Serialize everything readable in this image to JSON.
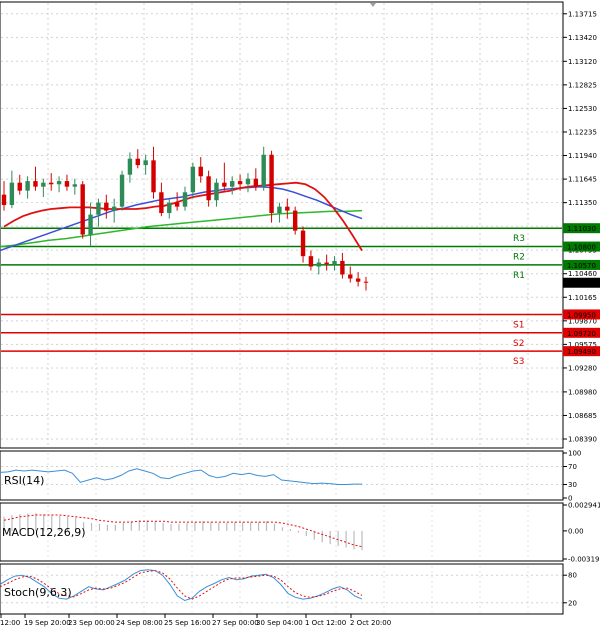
{
  "chart_data": {
    "type": "candlestick",
    "x_labels": [
      "12:00",
      "19 Sep 20:00",
      "23 Sep 00:00",
      "24 Sep 08:00",
      "25 Sep 16:00",
      "27 Sep 00:00",
      "30 Sep 04:00",
      "1 Oct 12:00",
      "2 Oct 20:00"
    ],
    "y_ticks": [
      1.13715,
      1.1342,
      1.1312,
      1.12825,
      1.1253,
      1.12235,
      1.1194,
      1.11645,
      1.1135,
      1.11055,
      1.10755,
      1.1046,
      1.10165,
      1.0987,
      1.09575,
      1.0928,
      1.0898,
      1.08685,
      1.0839
    ],
    "y_tick_labels": [
      "1.13715",
      "1.13420",
      "1.13120",
      "1.12825",
      "1.12530",
      "1.12235",
      "1.11940",
      "1.11645",
      "1.11350",
      "1.11055",
      "1.10755",
      "1.10460",
      "1.10165",
      "1.09870",
      "1.09575",
      "1.09280",
      "1.08980",
      "1.08685",
      "1.08390"
    ],
    "ylim": [
      1.0829,
      1.1385
    ],
    "current_price": {
      "label": "1.10347",
      "value": 1.10347
    },
    "levels": [
      {
        "name": "R3",
        "value": 1.1103,
        "label": "1.11030",
        "color": "#007a00"
      },
      {
        "name": "R2",
        "value": 1.108,
        "label": "1.10800",
        "color": "#007a00"
      },
      {
        "name": "R1",
        "value": 1.1057,
        "label": "1.10570",
        "color": "#007a00"
      },
      {
        "name": "S1",
        "value": 1.0995,
        "label": "1.09950",
        "color": "#e00000"
      },
      {
        "name": "S2",
        "value": 1.0972,
        "label": "1.09720",
        "color": "#e00000"
      },
      {
        "name": "S3",
        "value": 1.0949,
        "label": "1.09490",
        "color": "#e00000"
      }
    ],
    "candles": [
      {
        "o": 1.1145,
        "h": 1.1162,
        "l": 1.1125,
        "c": 1.1132
      },
      {
        "o": 1.1132,
        "h": 1.1175,
        "l": 1.1128,
        "c": 1.116
      },
      {
        "o": 1.116,
        "h": 1.117,
        "l": 1.1145,
        "c": 1.115
      },
      {
        "o": 1.115,
        "h": 1.1168,
        "l": 1.114,
        "c": 1.1162
      },
      {
        "o": 1.1162,
        "h": 1.118,
        "l": 1.115,
        "c": 1.1155
      },
      {
        "o": 1.1155,
        "h": 1.1165,
        "l": 1.1142,
        "c": 1.116
      },
      {
        "o": 1.116,
        "h": 1.1172,
        "l": 1.115,
        "c": 1.1158
      },
      {
        "o": 1.1158,
        "h": 1.1168,
        "l": 1.1148,
        "c": 1.1162
      },
      {
        "o": 1.1162,
        "h": 1.117,
        "l": 1.115,
        "c": 1.1155
      },
      {
        "o": 1.1155,
        "h": 1.1165,
        "l": 1.1145,
        "c": 1.1158
      },
      {
        "o": 1.1158,
        "h": 1.1162,
        "l": 1.109,
        "c": 1.1095
      },
      {
        "o": 1.1095,
        "h": 1.1135,
        "l": 1.108,
        "c": 1.112
      },
      {
        "o": 1.112,
        "h": 1.114,
        "l": 1.1105,
        "c": 1.1135
      },
      {
        "o": 1.1135,
        "h": 1.1145,
        "l": 1.1115,
        "c": 1.1125
      },
      {
        "o": 1.1125,
        "h": 1.114,
        "l": 1.111,
        "c": 1.113
      },
      {
        "o": 1.113,
        "h": 1.1175,
        "l": 1.1125,
        "c": 1.117
      },
      {
        "o": 1.117,
        "h": 1.1198,
        "l": 1.116,
        "c": 1.119
      },
      {
        "o": 1.119,
        "h": 1.1202,
        "l": 1.1178,
        "c": 1.1182
      },
      {
        "o": 1.1182,
        "h": 1.1195,
        "l": 1.117,
        "c": 1.1188
      },
      {
        "o": 1.1188,
        "h": 1.1205,
        "l": 1.114,
        "c": 1.1148
      },
      {
        "o": 1.1148,
        "h": 1.116,
        "l": 1.1118,
        "c": 1.1122
      },
      {
        "o": 1.1122,
        "h": 1.114,
        "l": 1.1115,
        "c": 1.1135
      },
      {
        "o": 1.1135,
        "h": 1.1148,
        "l": 1.1125,
        "c": 1.113
      },
      {
        "o": 1.113,
        "h": 1.1155,
        "l": 1.1125,
        "c": 1.1148
      },
      {
        "o": 1.1148,
        "h": 1.1185,
        "l": 1.114,
        "c": 1.118
      },
      {
        "o": 1.118,
        "h": 1.1192,
        "l": 1.116,
        "c": 1.1168
      },
      {
        "o": 1.1168,
        "h": 1.1175,
        "l": 1.113,
        "c": 1.1138
      },
      {
        "o": 1.1138,
        "h": 1.1165,
        "l": 1.113,
        "c": 1.116
      },
      {
        "o": 1.116,
        "h": 1.1185,
        "l": 1.115,
        "c": 1.1155
      },
      {
        "o": 1.1155,
        "h": 1.1168,
        "l": 1.1145,
        "c": 1.1162
      },
      {
        "o": 1.1162,
        "h": 1.117,
        "l": 1.115,
        "c": 1.1158
      },
      {
        "o": 1.1158,
        "h": 1.1172,
        "l": 1.1148,
        "c": 1.1165
      },
      {
        "o": 1.1165,
        "h": 1.1178,
        "l": 1.115,
        "c": 1.1155
      },
      {
        "o": 1.1155,
        "h": 1.1205,
        "l": 1.115,
        "c": 1.1195
      },
      {
        "o": 1.1195,
        "h": 1.12,
        "l": 1.111,
        "c": 1.1122
      },
      {
        "o": 1.1122,
        "h": 1.1135,
        "l": 1.111,
        "c": 1.113
      },
      {
        "o": 1.113,
        "h": 1.114,
        "l": 1.1115,
        "c": 1.1125
      },
      {
        "o": 1.1125,
        "h": 1.113,
        "l": 1.1095,
        "c": 1.11
      },
      {
        "o": 1.11,
        "h": 1.1105,
        "l": 1.106,
        "c": 1.1068
      },
      {
        "o": 1.1068,
        "h": 1.1075,
        "l": 1.105,
        "c": 1.1055
      },
      {
        "o": 1.1055,
        "h": 1.1065,
        "l": 1.1045,
        "c": 1.106
      },
      {
        "o": 1.106,
        "h": 1.107,
        "l": 1.105,
        "c": 1.1058
      },
      {
        "o": 1.1058,
        "h": 1.1068,
        "l": 1.105,
        "c": 1.1062
      },
      {
        "o": 1.1062,
        "h": 1.1072,
        "l": 1.104,
        "c": 1.1045
      },
      {
        "o": 1.1045,
        "h": 1.1055,
        "l": 1.1035,
        "c": 1.104
      },
      {
        "o": 1.104,
        "h": 1.1048,
        "l": 1.103,
        "c": 1.1036
      },
      {
        "o": 1.1036,
        "h": 1.1042,
        "l": 1.1025,
        "c": 1.1035
      }
    ],
    "ma_red": [
      1.1105,
      1.1112,
      1.1118,
      1.1122,
      1.1125,
      1.1127,
      1.1128,
      1.1129,
      1.1129,
      1.1129,
      1.1128,
      1.1127,
      1.1127,
      1.1127,
      1.1127,
      1.1128,
      1.113,
      1.1131,
      1.1134,
      1.1138,
      1.1142,
      1.1144,
      1.1146,
      1.1148,
      1.115,
      1.1153,
      1.1155,
      1.1156,
      1.1157,
      1.1158,
      1.1159,
      1.116,
      1.1158,
      1.1152,
      1.1142,
      1.1128,
      1.1112,
      1.1094,
      1.1075
    ],
    "ma_blue": [
      1.1075,
      1.108,
      1.1085,
      1.109,
      1.1095,
      1.11,
      1.1105,
      1.111,
      1.1115,
      1.112,
      1.1125,
      1.1128,
      1.1132,
      1.1135,
      1.1138,
      1.114,
      1.1142,
      1.1145,
      1.1148,
      1.115,
      1.1152,
      1.1153,
      1.1154,
      1.1155,
      1.1154,
      1.1152,
      1.1148,
      1.1143,
      1.1138,
      1.1132,
      1.1126,
      1.112,
      1.1115
    ],
    "ma_green": [
      1.108,
      1.1082,
      1.1085,
      1.1088,
      1.109,
      1.1093,
      1.1096,
      1.1099,
      1.1102,
      1.1105,
      1.1107,
      1.1109,
      1.1111,
      1.1113,
      1.1115,
      1.1117,
      1.1119,
      1.1121,
      1.1122,
      1.1123,
      1.1124,
      1.1124,
      1.1125
    ],
    "rsi": {
      "label": "RSI(14)",
      "y_ticks": [
        100,
        70,
        30,
        0
      ],
      "y_tick_labels": [
        "100",
        "70",
        "30",
        "0"
      ],
      "values": [
        57,
        58,
        62,
        60,
        62,
        60,
        58,
        60,
        62,
        55,
        35,
        40,
        45,
        40,
        43,
        50,
        60,
        65,
        60,
        55,
        45,
        43,
        50,
        55,
        60,
        62,
        50,
        45,
        48,
        55,
        52,
        55,
        50,
        48,
        52,
        40,
        38,
        36,
        34,
        32,
        33,
        32,
        30,
        30,
        31,
        31
      ]
    },
    "macd": {
      "label": "MACD(12,26,9)",
      "y_ticks": [
        0.002941,
        0.0,
        -0.003195
      ],
      "y_tick_labels": [
        "0.002941",
        "0.00",
        "-0.003195"
      ],
      "hist": [
        0.0016,
        0.0018,
        0.0019,
        0.002,
        0.002,
        0.0019,
        0.0018,
        0.0017,
        0.0016,
        0.0015,
        0.001,
        0.0009,
        0.0008,
        0.0007,
        0.0007,
        0.0009,
        0.0011,
        0.0012,
        0.0012,
        0.0011,
        0.0009,
        0.0008,
        0.0008,
        0.0009,
        0.001,
        0.0011,
        0.001,
        0.0009,
        0.0009,
        0.001,
        0.001,
        0.001,
        0.001,
        0.0011,
        0.0008,
        0.0004,
        0.0002,
        -0.0002,
        -0.0006,
        -0.001,
        -0.0013,
        -0.0015,
        -0.0017,
        -0.0019,
        -0.0021,
        -0.0022
      ],
      "signal": [
        0.0012,
        0.0014,
        0.0016,
        0.0017,
        0.0018,
        0.0018,
        0.0018,
        0.0018,
        0.0017,
        0.0016,
        0.0015,
        0.0014,
        0.0012,
        0.0011,
        0.001,
        0.001,
        0.001,
        0.0011,
        0.0011,
        0.0011,
        0.0011,
        0.001,
        0.001,
        0.001,
        0.001,
        0.001,
        0.001,
        0.001,
        0.001,
        0.001,
        0.001,
        0.001,
        0.001,
        0.001,
        0.001,
        0.0009,
        0.0007,
        0.0005,
        0.0002,
        -0.0001,
        -0.0004,
        -0.0007,
        -0.001,
        -0.0013,
        -0.0016,
        -0.0018
      ]
    },
    "stoch": {
      "label": "Stoch(9,6,3)",
      "y_ticks": [
        80,
        20
      ],
      "y_tick_labels": [
        "80",
        "20"
      ],
      "k": [
        60,
        70,
        78,
        80,
        75,
        65,
        55,
        40,
        30,
        28,
        35,
        45,
        55,
        50,
        48,
        55,
        62,
        70,
        82,
        90,
        92,
        90,
        80,
        60,
        35,
        25,
        30,
        45,
        55,
        62,
        70,
        75,
        70,
        72,
        78,
        80,
        82,
        75,
        60,
        40,
        32,
        28,
        30,
        35,
        42,
        50,
        55,
        48,
        35,
        28
      ],
      "d": [
        55,
        62,
        70,
        76,
        78,
        72,
        62,
        50,
        40,
        35,
        33,
        40,
        48,
        52,
        50,
        52,
        58,
        65,
        75,
        85,
        88,
        90,
        85,
        72,
        52,
        35,
        28,
        35,
        45,
        55,
        65,
        72,
        74,
        74,
        76,
        78,
        80,
        78,
        70,
        55,
        42,
        35,
        32,
        34,
        38,
        45,
        50,
        52,
        45,
        36
      ]
    }
  }
}
